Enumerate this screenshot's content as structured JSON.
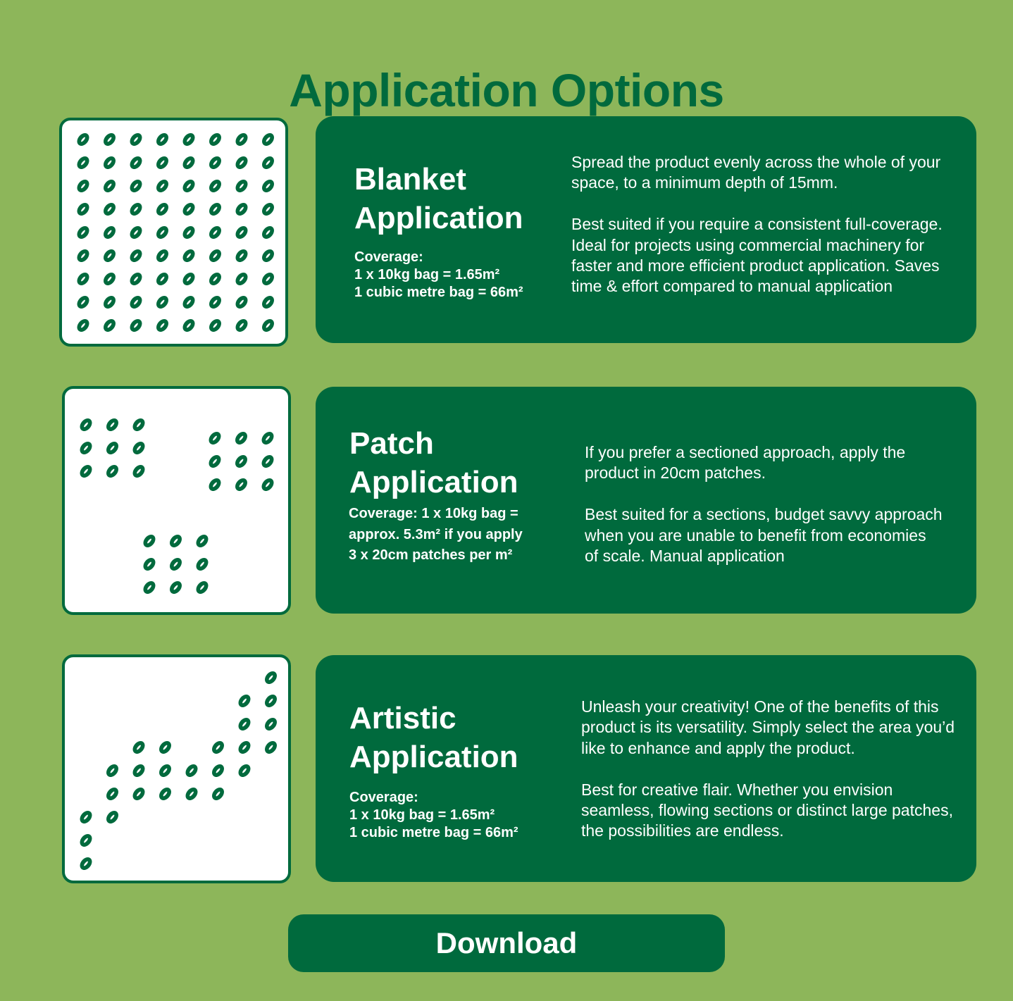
{
  "page": {
    "title": "Application Options",
    "colors": {
      "background": "#8db65a",
      "primary": "#006a3d",
      "card_fill": "#ffffff",
      "text_on_primary": "#ffffff"
    }
  },
  "options": [
    {
      "heading_line1": "Blanket",
      "heading_line2": "Application",
      "coverage_lines": [
        "Coverage:",
        "1 x 10kg bag = 1.65m²",
        "1 cubic metre bag = 66m²"
      ],
      "description_paragraphs": [
        "Spread the product evenly across the whole of your space, to a minimum depth of 15mm.",
        "Best suited if you require a consistent full-coverage. Ideal for projects using commercial machinery for faster and more efficient product application. Saves time & effort compared to manual application"
      ],
      "illustration": {
        "icon": "seed-icon",
        "grid_columns": 8,
        "grid_rows": 9,
        "seeds": "all"
      }
    },
    {
      "heading_line1": "Patch",
      "heading_line2": "Application",
      "coverage_lines": [
        "Coverage: 1 x 10kg bag =",
        "approx. 5.3m² if you apply",
        "3 x 20cm patches per m²"
      ],
      "description_paragraphs": [
        "If you prefer a sectioned approach, apply the product in 20cm patches.",
        "Best suited for a sections, budget savvy approach when you are unable to benefit from economies of scale. Manual application"
      ],
      "illustration": {
        "icon": "seed-icon",
        "patches": 3,
        "seeds_per_patch": "3x3"
      }
    },
    {
      "heading_line1": "Artistic",
      "heading_line2": "Application",
      "coverage_lines": [
        "Coverage:",
        "1 x 10kg bag = 1.65m²",
        "1 cubic metre bag = 66m²"
      ],
      "description_paragraphs": [
        "Unleash your creativity! One of the benefits of this product is its versatility. Simply select the area you’d like to enhance and apply the product.",
        "Best for creative flair. Whether you envision seamless, flowing sections or distinct large patches, the possibilities are endless."
      ],
      "illustration": {
        "icon": "seed-icon",
        "grid_columns": 8,
        "grid_rows": 9,
        "seed_cells_row_col": [
          [
            0,
            7
          ],
          [
            1,
            6
          ],
          [
            1,
            7
          ],
          [
            2,
            6
          ],
          [
            2,
            7
          ],
          [
            3,
            2
          ],
          [
            3,
            3
          ],
          [
            3,
            5
          ],
          [
            3,
            6
          ],
          [
            3,
            7
          ],
          [
            4,
            1
          ],
          [
            4,
            2
          ],
          [
            4,
            3
          ],
          [
            4,
            4
          ],
          [
            4,
            5
          ],
          [
            4,
            6
          ],
          [
            5,
            1
          ],
          [
            5,
            2
          ],
          [
            5,
            3
          ],
          [
            5,
            4
          ],
          [
            5,
            5
          ],
          [
            6,
            0
          ],
          [
            6,
            1
          ],
          [
            7,
            0
          ],
          [
            8,
            0
          ]
        ]
      }
    }
  ],
  "download_button": {
    "label": "Download"
  }
}
